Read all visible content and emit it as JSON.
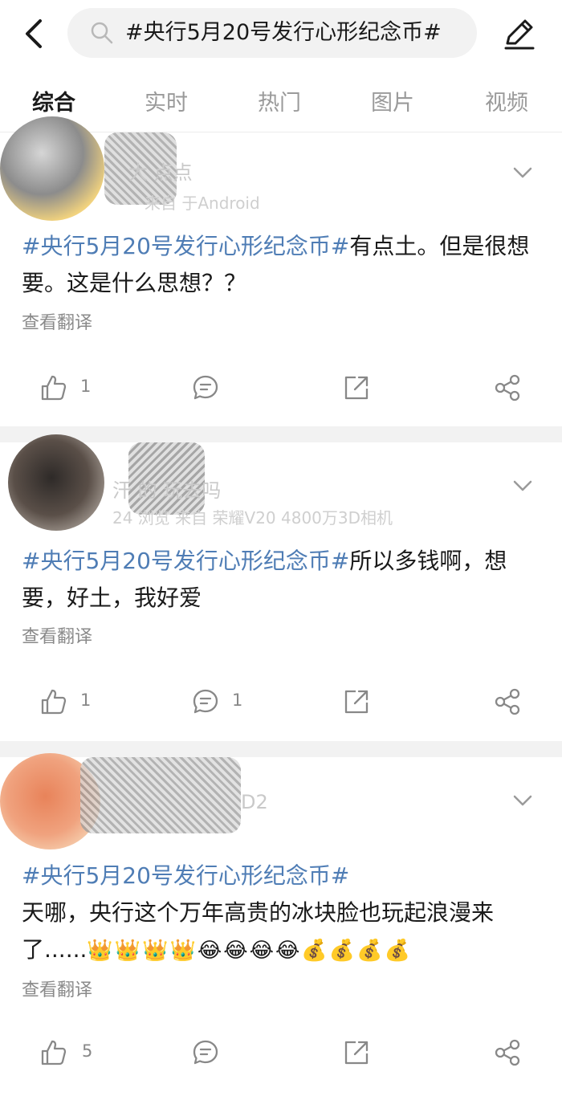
{
  "search": {
    "query": "#央行5月20号发行心形纪念币#"
  },
  "tabs": [
    {
      "label": "综合",
      "active": true
    },
    {
      "label": "实时"
    },
    {
      "label": "热门"
    },
    {
      "label": "图片"
    },
    {
      "label": "视频"
    }
  ],
  "accent_color": "#ff8200",
  "hashtag_color": "#4f7db5",
  "posts": [
    {
      "username": "大 点点",
      "meta": "来自 于Android",
      "hashtag": "#央行5月20号发行心形纪念币#",
      "text": "有点土。但是很想要。这是什么思想？？",
      "translate": "查看翻译",
      "likes": "1",
      "comments": "",
      "avatar_color": "#e6c36a"
    },
    {
      "username": "汗 的 玩去吗",
      "meta": "24 浏览 来自 荣耀V20 4800万3D相机",
      "hashtag": "#央行5月20号发行心形纪念币#",
      "text": "所以多钱啊，想要，好土，我好爱",
      "translate": "查看翻译",
      "likes": "1",
      "comments": "1",
      "avatar_color": "#6b5e55"
    },
    {
      "username": "D2",
      "meta": "",
      "hashtag": "#央行5月20号发行心形纪念币#",
      "text": "天哪，央行这个万年高贵的冰块脸也玩起浪漫来了......",
      "emoji": "👑👑👑👑😂😂😂😂💰💰💰💰",
      "translate": "查看翻译",
      "likes": "5",
      "comments": "",
      "avatar_color": "#e8835a"
    }
  ]
}
